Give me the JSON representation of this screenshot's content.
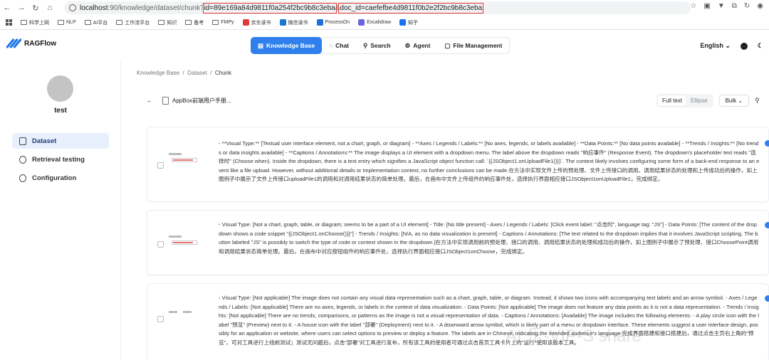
{
  "browser": {
    "url_host": "localhost",
    "url_path": ":90/knowledge/dataset/chunk?",
    "url_param_id": "id=89e169a84d9811f0a254f2bc9b8c3eba",
    "url_amp": "&",
    "url_param_doc": "doc_id=caefefbe4d9811f0b2e2f2bc9b8c3eba",
    "bookmarks": [
      {
        "label": "科学上网"
      },
      {
        "label": "NLP"
      },
      {
        "label": "AI平台"
      },
      {
        "label": "工作流平台"
      },
      {
        "label": "知识"
      },
      {
        "label": "备考"
      },
      {
        "label": "FMPy"
      },
      {
        "label": "京东读书"
      },
      {
        "label": "微信读书"
      },
      {
        "label": "ProcessOn"
      },
      {
        "label": "Excalidraw"
      },
      {
        "label": "知乎"
      }
    ]
  },
  "app": {
    "name": "RAGFlow",
    "nav": [
      {
        "label": "Knowledge Base",
        "active": true
      },
      {
        "label": "Chat"
      },
      {
        "label": "Search"
      },
      {
        "label": "Agent"
      },
      {
        "label": "File Management"
      }
    ],
    "language": "English",
    "accent": "#2f80ed"
  },
  "sidebar": {
    "username": "test",
    "items": [
      {
        "label": "Dataset",
        "active": true
      },
      {
        "label": "Retrieval testing"
      },
      {
        "label": "Configuration"
      }
    ]
  },
  "main": {
    "breadcrumb": [
      "Knowledge Base",
      "Dataset",
      "Chunk"
    ],
    "doc_title": "AppBox前端用户手册...",
    "view_modes": [
      "Full text",
      "Ellipse"
    ],
    "bulk_label": "Bulk",
    "chunks": [
      {
        "text": "- **Visual Type:** [Textual user interface element, not a chart, graph, or diagram] - **Axes / Legends / Labels:** [No axes, legends, or labels available] - **Data Points:** [No data points available] - **Trends / Insights:** [No trends or data insights available] - **Captions / Annotations:** The image displays a UI element with a dropdown menu. The label above the dropdown reads \"响应事件\" (Response Event). The dropdown's placeholder text reads \"选择时\" (Choose when). Inside the dropdown, there is a text entry which signifies a JavaScript object function call: `{{JSObject1.onUploadFile1()}}`. The context likely involves configuring some form of a back-end response to an event like a file upload. However, without additional details or implementation context, no further conclusions can be made.在方法中实现文件上传的预处理、文件上传接口的调用、调用结果状态的处理和上传成功后的操作，如上图例子中展示了文件上传接口uploadFile1的调用和对调用结果状态的简单处理。最后，在画布中文件上传组件的响应事件处，选择执行界面相应接口JSObject1onUploadFile1，完成绑定。"
      },
      {
        "text": "- Visual Type: [Not a chart, graph, table, or diagram; seems to be a part of a UI element] - Title: [No title present] - Axes / Legends / Labels: [Click event label: \"点击时\", language tag: \"JS\"] - Data Points: [The content of the dropdown shows a code snippet \"{{JSObject1.onChoose()}}\"] - Trends / Insights: [N/A, as no data visualization is present] - Captions / Annotations: [The text related to the dropdown implies that it involves JavaScript scripting. The button labeled \"JS\" is possibly to switch the type of code or context shown in the dropdown.]在方法中实现调用前的预处理、接口的调用、调用结果状态的处理和成功后的操作，如上图例子中展示了预处理、接口ChoosePoint调用和调用结果状态简单处理。最后，在画布中对应按钮组件的响应事件处，选择执行界面相应接口JSObject1onChoose，完成绑定。"
      },
      {
        "text": "- Visual Type: [Not applicable] The image does not contain any visual data representation such as a chart, graph, table, or diagram. Instead, it shows two icons with accompanying text labels and an arrow symbol. - Axes / Legends / Labels: [Not applicable] There are no axes, legends, or labels in the context of data visualization. - Data Points: [Not applicable] The image does not feature any data points as it is not a data representation. - Trends / Insights: [Not applicable] There are no trends, comparisons, or patterns as the image is not a visual representation of data. - Captions / Annotations: [Available] The image includes the following elements: - A play circle icon with the label \"预览\" (Preview) next to it. - A house icon with the label \"部署\" (Deployment) next to it. - A downward arrow symbol, which is likely part of a menu or dropdown interface. These elements suggest a user interface design, possibly for an application or website, where users can select options to preview or deploy a feature. The labels are in Chinese, indicating the intended audience's language.完成界面搭建和接口搭建后，通过点击主页右上角的\"预览\"，可对工具进行上线前测试；测试无问题后，点击\"部署\"对工具进行发布，所有该工具的使用者可通过点击首页工具卡片上的\"运行\"使用该版本工具。"
      }
    ]
  },
  "watermark": "AI 乐-VIP-S share"
}
